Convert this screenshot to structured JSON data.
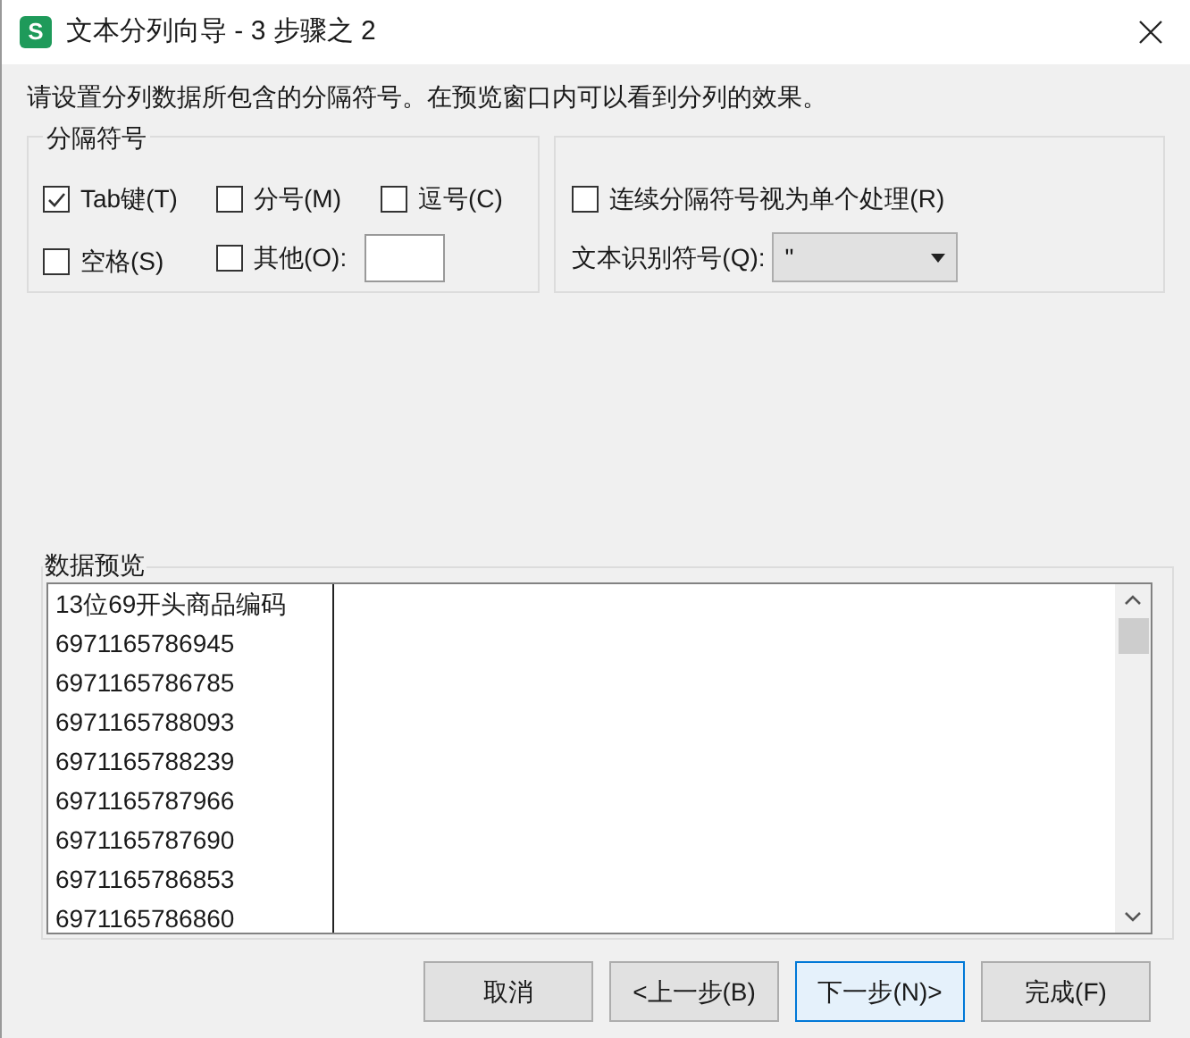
{
  "window": {
    "title": "文本分列向导 - 3 步骤之 2",
    "app_icon": "S"
  },
  "instruction": "请设置分列数据所包含的分隔符号。在预览窗口内可以看到分列的效果。",
  "delimiters": {
    "title": "分隔符号",
    "options": [
      {
        "label": "Tab键(T)",
        "checked": true
      },
      {
        "label": "分号(M)",
        "checked": false
      },
      {
        "label": "逗号(C)",
        "checked": false
      },
      {
        "label": "空格(S)",
        "checked": false
      },
      {
        "label": "其他(O):",
        "checked": false
      }
    ]
  },
  "consecutive": {
    "label": "连续分隔符号视为单个处理(R)",
    "checked": false
  },
  "text_qualifier": {
    "label": "文本识别符号(Q):",
    "value": "\""
  },
  "preview": {
    "title": "数据预览",
    "rows": [
      "13位69开头商品编码",
      "6971165786945",
      "6971165786785",
      "6971165788093",
      "6971165788239",
      "6971165787966",
      "6971165787690",
      "6971165786853",
      "6971165786860"
    ]
  },
  "buttons": [
    {
      "label": "取消",
      "focused": false
    },
    {
      "label": "<上一步(B)",
      "focused": false
    },
    {
      "label": "下一步(N)>",
      "focused": true
    },
    {
      "label": "完成(F)",
      "focused": false
    }
  ]
}
